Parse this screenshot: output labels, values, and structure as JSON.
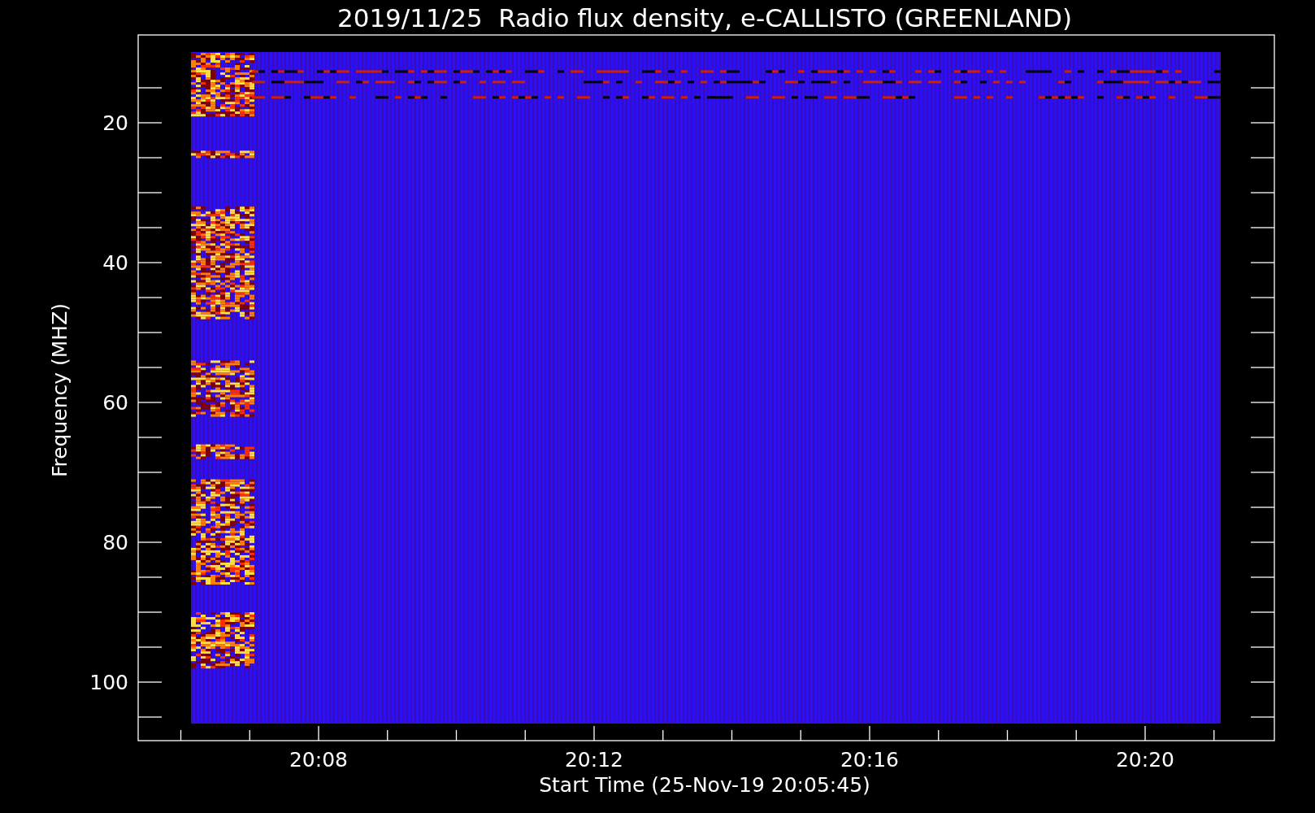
{
  "title": "2019/11/25  Radio flux density, e-CALLISTO (GREENLAND)",
  "plot": {
    "ylabel": "Frequency (MHZ)",
    "xlabel": "Start Time (25-Nov-19 20:05:45)",
    "yticks": [
      "20",
      "40",
      "60",
      "80",
      "100"
    ],
    "xticks": [
      "20:08",
      "20:12",
      "20:16",
      "20:20"
    ]
  }
}
